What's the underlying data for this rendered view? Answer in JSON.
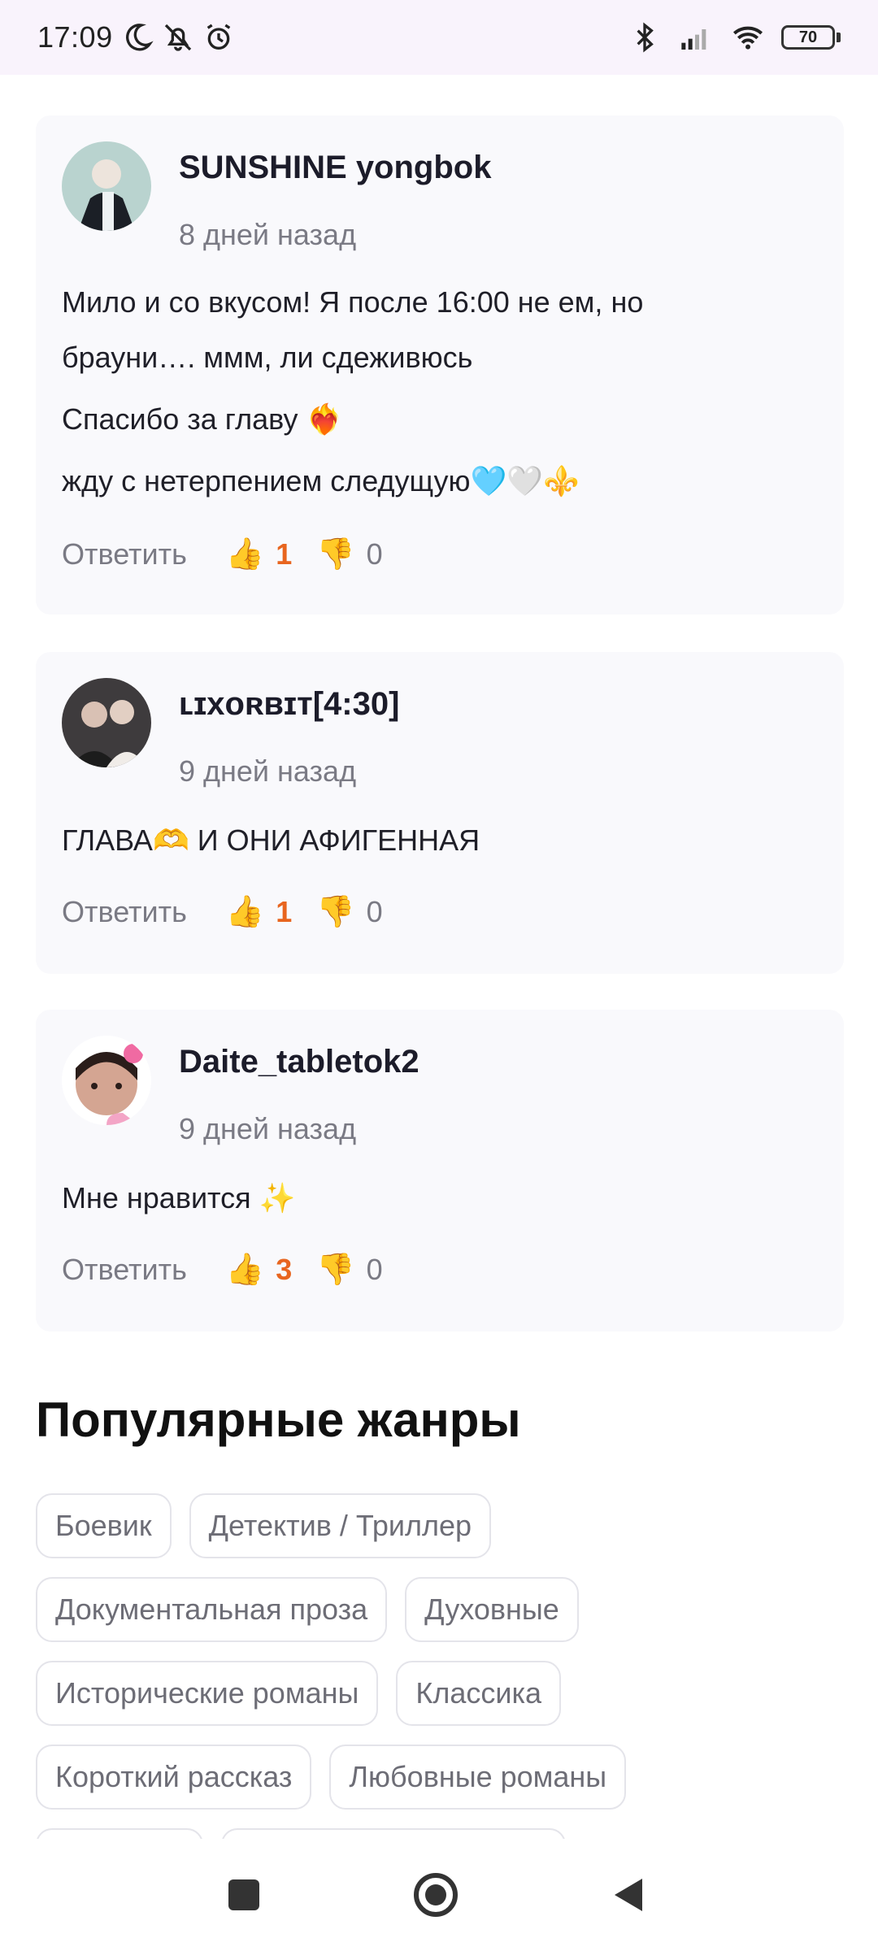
{
  "status_bar": {
    "time": "17:09",
    "icons_left": [
      "moon-icon",
      "muted-bell-icon",
      "alarm-icon"
    ],
    "icons_right": [
      "bluetooth-icon",
      "signal-icon",
      "wifi-icon"
    ],
    "battery": "70"
  },
  "comments": [
    {
      "author": "SUNSHINE yongbok",
      "date": "8 дней назад",
      "lines": [
        "Мило и со вкусом! Я после 16:00 не ем, но",
        "брауни…. ммм, ли сдеживюсь",
        "Спасибо за главу ❤️‍🔥",
        "жду с нетерпением следущую🩵🤍⚜️"
      ],
      "reply_label": "Ответить",
      "likes": "1",
      "dislikes": "0"
    },
    {
      "author": "ʟɪxᴏʀʙɪᴛ[4:30]",
      "date": "9 дней назад",
      "lines": [
        "ГЛАВА🫶 И ОНИ АФИГЕННАЯ"
      ],
      "reply_label": "Ответить",
      "likes": "1",
      "dislikes": "0"
    },
    {
      "author": "Daite_tabletok2",
      "date": "9 дней назад",
      "lines": [
        "Мне нравится ✨"
      ],
      "reply_label": "Ответить",
      "likes": "3",
      "dislikes": "0"
    }
  ],
  "genres": {
    "title": "Популярные жанры",
    "rows": [
      [
        "Боевик",
        "Детектив / Триллер"
      ],
      [
        "Документальная проза",
        "Духовные"
      ],
      [
        "Исторические романы",
        "Классика"
      ],
      [
        "Короткий рассказ",
        "Любовные романы"
      ]
    ]
  },
  "icons": {
    "like": "👍",
    "dislike": "👎"
  },
  "colors": {
    "status_bar_bg": "#f9f3fc",
    "card_bg": "#f9f9fc",
    "like_count": "#e8651f",
    "muted_text": "#7a7a84"
  }
}
